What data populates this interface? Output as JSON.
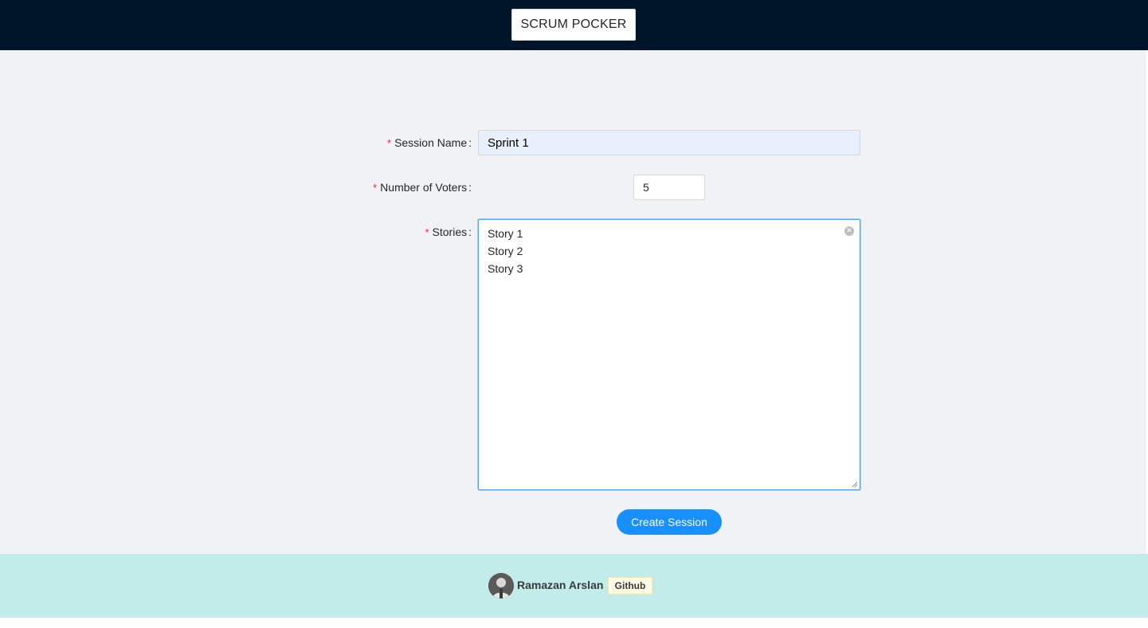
{
  "header": {
    "logo_label": "SCRUM POCKER"
  },
  "form": {
    "session_name": {
      "label": "Session Name",
      "value": "Sprint 1"
    },
    "voters": {
      "label": "Number of Voters",
      "value": "5"
    },
    "stories": {
      "label": "Stories",
      "value": "Story 1\nStory 2\nStory 3"
    },
    "required_mark": "*",
    "colon": ":",
    "submit_label": "Create Session"
  },
  "footer": {
    "author": "Ramazan Arslan",
    "github_label": "Github"
  },
  "icons": {
    "clear": "close-circle-icon",
    "avatar": "avatar-photo"
  },
  "colors": {
    "header_bg": "#001529",
    "content_bg": "#f0f2f5",
    "footer_bg": "#c2ece9",
    "primary": "#1890ff",
    "required": "#f5222d"
  }
}
